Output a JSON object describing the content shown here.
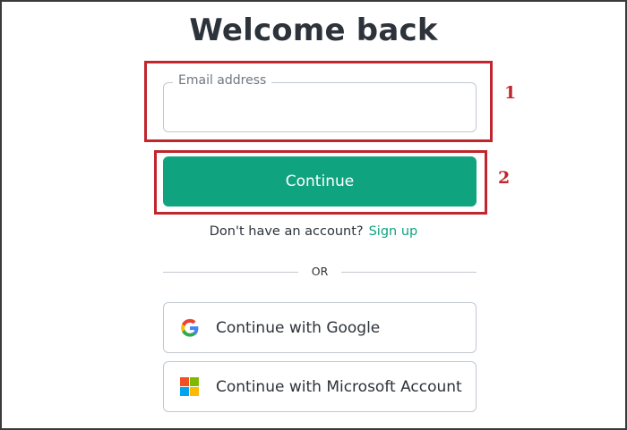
{
  "header": {
    "title": "Welcome back"
  },
  "email_field": {
    "label": "Email address",
    "value": "",
    "placeholder": ""
  },
  "continue_button": {
    "label": "Continue"
  },
  "signup": {
    "prompt": "Don't have an account?",
    "link": "Sign up"
  },
  "divider": {
    "text": "OR"
  },
  "social_buttons": [
    {
      "label": "Continue with Google",
      "icon": "google-icon"
    },
    {
      "label": "Continue with Microsoft Account",
      "icon": "microsoft-icon"
    }
  ],
  "annotations": [
    {
      "number": "1",
      "target": "email-field"
    },
    {
      "number": "2",
      "target": "continue-button"
    }
  ],
  "colors": {
    "accent": "#10a37f",
    "annotation": "#c0262d",
    "text": "#2d333a",
    "border": "#c2c8d0",
    "microsoft": [
      "#f25022",
      "#7fba00",
      "#00a4ef",
      "#ffb900"
    ],
    "google": [
      "#4285f4",
      "#34a853",
      "#fbbc05",
      "#ea4335"
    ]
  }
}
